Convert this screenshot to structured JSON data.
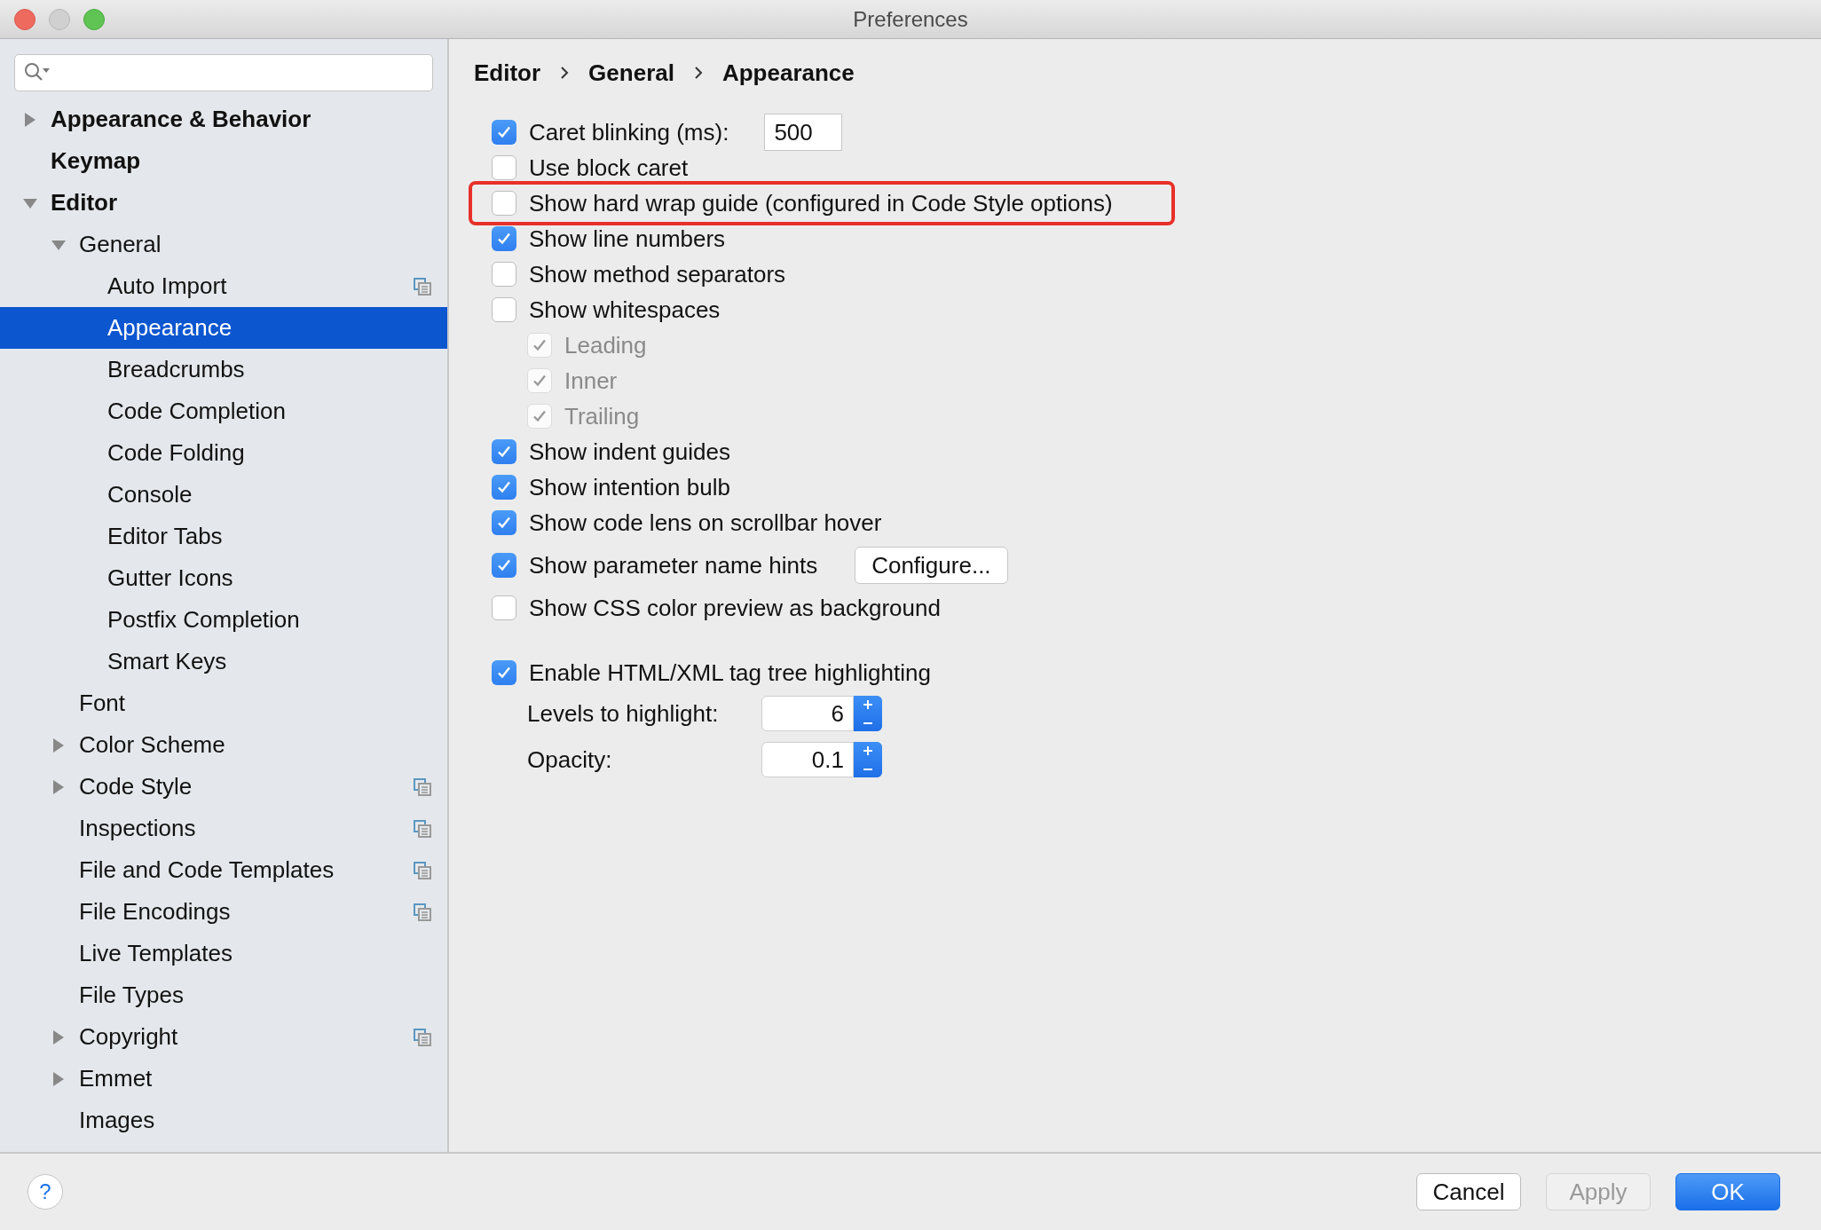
{
  "window": {
    "title": "Preferences"
  },
  "sidebar": {
    "items": [
      {
        "label": "Appearance & Behavior",
        "expanded": false,
        "selected": false
      },
      {
        "label": "Keymap",
        "selected": false
      },
      {
        "label": "Editor",
        "expanded": true,
        "selected": false,
        "children": [
          {
            "label": "General",
            "expanded": true,
            "selected": false,
            "children": [
              {
                "label": "Auto Import",
                "selected": false,
                "per_project": true
              },
              {
                "label": "Appearance",
                "selected": true
              },
              {
                "label": "Breadcrumbs",
                "selected": false
              },
              {
                "label": "Code Completion",
                "selected": false
              },
              {
                "label": "Code Folding",
                "selected": false
              },
              {
                "label": "Console",
                "selected": false
              },
              {
                "label": "Editor Tabs",
                "selected": false
              },
              {
                "label": "Gutter Icons",
                "selected": false
              },
              {
                "label": "Postfix Completion",
                "selected": false
              },
              {
                "label": "Smart Keys",
                "selected": false
              }
            ]
          },
          {
            "label": "Font",
            "selected": false
          },
          {
            "label": "Color Scheme",
            "expanded": false,
            "selected": false
          },
          {
            "label": "Code Style",
            "expanded": false,
            "selected": false,
            "per_project": true
          },
          {
            "label": "Inspections",
            "selected": false,
            "per_project": true
          },
          {
            "label": "File and Code Templates",
            "selected": false,
            "per_project": true
          },
          {
            "label": "File Encodings",
            "selected": false,
            "per_project": true
          },
          {
            "label": "Live Templates",
            "selected": false
          },
          {
            "label": "File Types",
            "selected": false
          },
          {
            "label": "Copyright",
            "expanded": false,
            "selected": false,
            "per_project": true
          },
          {
            "label": "Emmet",
            "expanded": false,
            "selected": false
          },
          {
            "label": "Images",
            "selected": false
          }
        ]
      }
    ]
  },
  "breadcrumb": [
    "Editor",
    "General",
    "Appearance"
  ],
  "options": [
    {
      "kind": "checkbox_field",
      "label": "Caret blinking (ms):",
      "checked": true,
      "value": "500",
      "highlighted": false
    },
    {
      "kind": "checkbox",
      "label": "Use block caret",
      "checked": false,
      "highlighted": false
    },
    {
      "kind": "checkbox",
      "label": "Show hard wrap guide (configured in Code Style options)",
      "checked": false,
      "highlighted": true
    },
    {
      "kind": "checkbox",
      "label": "Show line numbers",
      "checked": true,
      "highlighted": false
    },
    {
      "kind": "checkbox",
      "label": "Show method separators",
      "checked": false,
      "highlighted": false
    },
    {
      "kind": "checkbox",
      "label": "Show whitespaces",
      "checked": false,
      "highlighted": false,
      "children": [
        {
          "kind": "checkbox",
          "label": "Leading",
          "checked": true,
          "disabled": true,
          "highlighted": false
        },
        {
          "kind": "checkbox",
          "label": "Inner",
          "checked": true,
          "disabled": true,
          "highlighted": false
        },
        {
          "kind": "checkbox",
          "label": "Trailing",
          "checked": true,
          "disabled": true,
          "highlighted": false
        }
      ]
    },
    {
      "kind": "checkbox",
      "label": "Show indent guides",
      "checked": true,
      "highlighted": false
    },
    {
      "kind": "checkbox",
      "label": "Show intention bulb",
      "checked": true,
      "highlighted": false
    },
    {
      "kind": "checkbox",
      "label": "Show code lens on scrollbar hover",
      "checked": true,
      "highlighted": false
    },
    {
      "kind": "checkbox_button",
      "label": "Show parameter name hints",
      "checked": true,
      "button": "Configure...",
      "highlighted": false
    },
    {
      "kind": "checkbox",
      "label": "Show CSS color preview as background",
      "checked": false,
      "highlighted": false
    }
  ],
  "tag_tree": {
    "label": "Enable HTML/XML tag tree highlighting",
    "checked": true,
    "spinners": [
      {
        "label": "Levels to highlight:",
        "value": "6"
      },
      {
        "label": "Opacity:",
        "value": "0.1"
      }
    ]
  },
  "footer": {
    "help": "?",
    "buttons": [
      {
        "label": "Cancel",
        "disabled": false,
        "default": false
      },
      {
        "label": "Apply",
        "disabled": true,
        "default": false
      },
      {
        "label": "OK",
        "disabled": false,
        "default": true
      }
    ]
  }
}
